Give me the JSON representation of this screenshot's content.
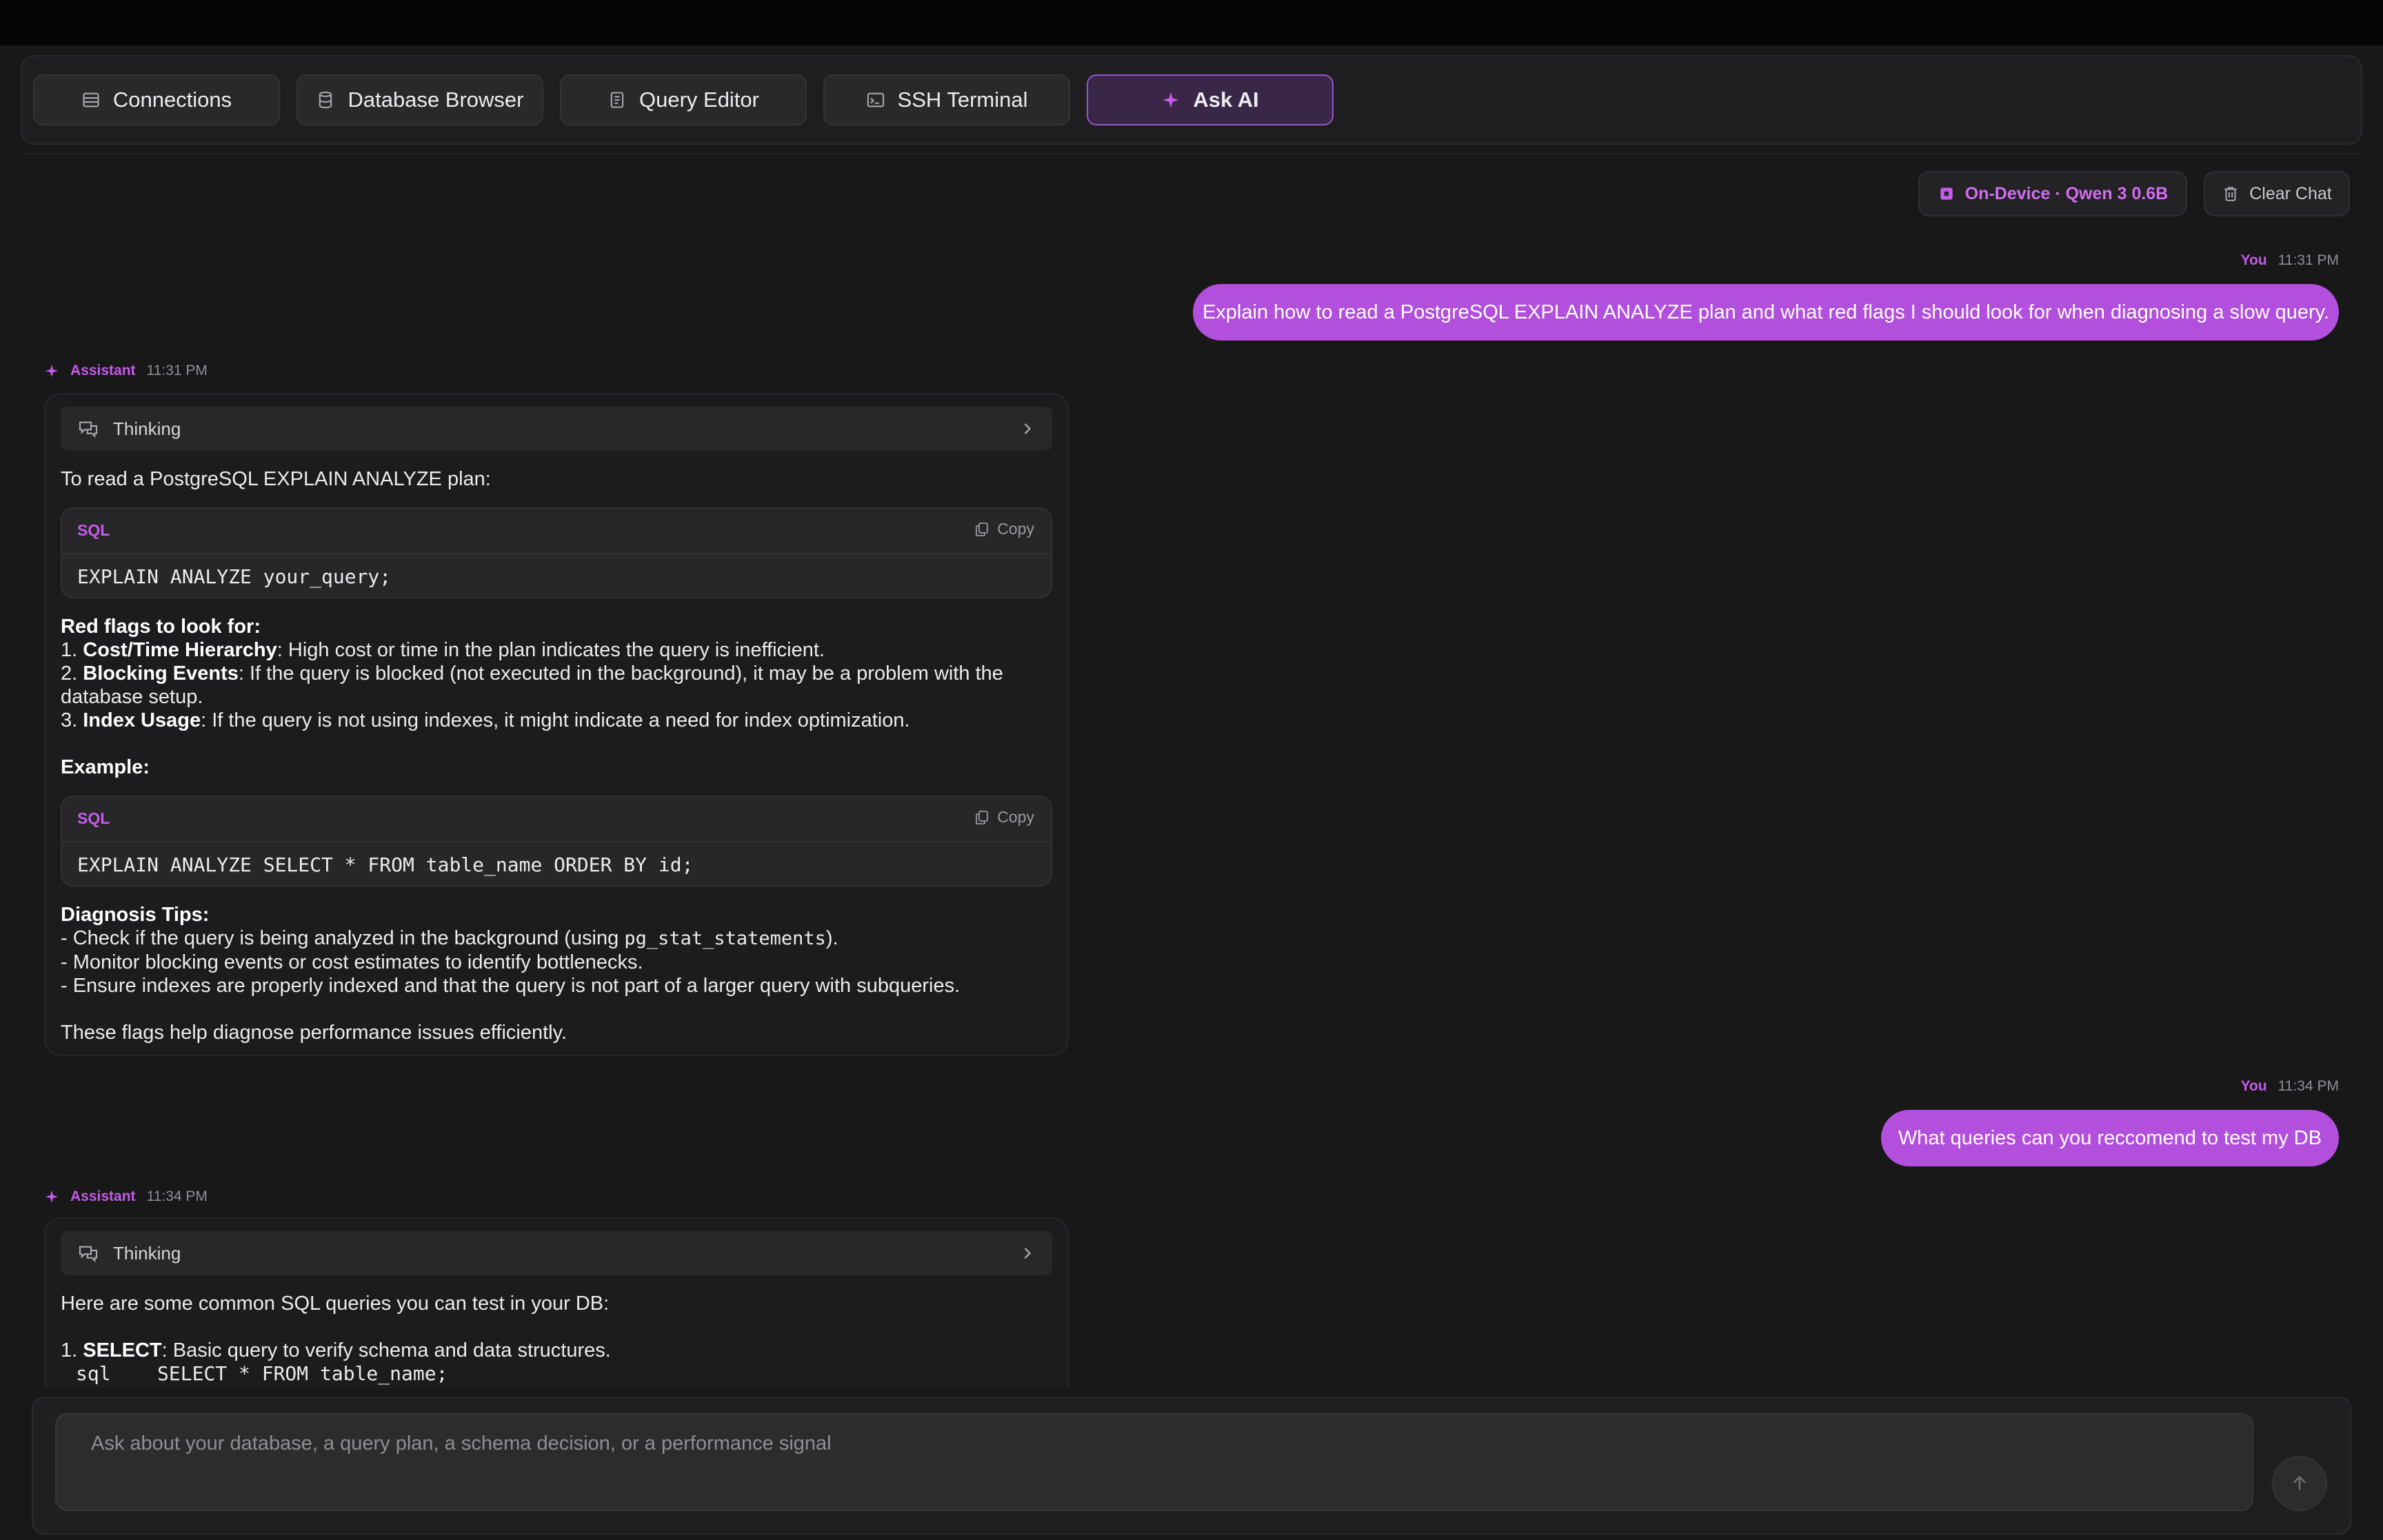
{
  "tabs": [
    {
      "label": "Connections",
      "icon": "server-icon"
    },
    {
      "label": "Database Browser",
      "icon": "database-icon"
    },
    {
      "label": "Query Editor",
      "icon": "file-icon"
    },
    {
      "label": "SSH Terminal",
      "icon": "terminal-icon"
    },
    {
      "label": "Ask AI",
      "icon": "sparkle-icon",
      "active": true
    }
  ],
  "header": {
    "model_label": "On-Device · Qwen 3 0.6B",
    "clear_label": "Clear Chat"
  },
  "messages": {
    "user1": {
      "who": "You",
      "time": "11:31 PM",
      "text": "Explain how to read a PostgreSQL EXPLAIN ANALYZE plan and what red flags I should look for when diagnosing a slow query."
    },
    "assistant1": {
      "who": "Assistant",
      "time": "11:31 PM",
      "thinking": "Thinking",
      "intro": "To read a PostgreSQL EXPLAIN ANALYZE plan:",
      "code1": {
        "lang": "SQL",
        "copy": "Copy",
        "code": "EXPLAIN ANALYZE your_query;"
      },
      "redflags_title": "Red flags to look for:",
      "flag1_num": "1. ",
      "flag1_bold": "Cost/Time Hierarchy",
      "flag1_rest": ": High cost or time in the plan indicates the query is inefficient.",
      "flag2_num": "2. ",
      "flag2_bold": "Blocking Events",
      "flag2_rest": ": If the query is blocked (not executed in the background), it may be a problem with the database setup.",
      "flag3_num": "3. ",
      "flag3_bold": "Index Usage",
      "flag3_rest": ": If the query is not using indexes, it might indicate a need for index optimization.",
      "example_title": "Example:",
      "code2": {
        "lang": "SQL",
        "copy": "Copy",
        "code": "EXPLAIN ANALYZE SELECT * FROM table_name ORDER BY id;"
      },
      "tips_title": "Diagnosis Tips:",
      "tip1_pre": "- Check if the query is being analyzed in the background (using ",
      "tip1_code": "pg_stat_statements",
      "tip1_post": ").",
      "tip2": "- Monitor blocking events or cost estimates to identify bottlenecks.",
      "tip3": "- Ensure indexes are properly indexed and that the query is not part of a larger query with subqueries.",
      "closing": "These flags help diagnose performance issues efficiently."
    },
    "user2": {
      "who": "You",
      "time": "11:34 PM",
      "text": "What queries can you reccomend to test my DB"
    },
    "assistant2": {
      "who": "Assistant",
      "time": "11:34 PM",
      "thinking": "Thinking",
      "intro": "Here are some common SQL queries you can test in your DB:",
      "item1_num": "1. ",
      "item1_bold": "SELECT",
      "item1_rest": ": Basic query to verify schema and data structures.",
      "item1_code": "sql    SELECT * FROM table_name;"
    }
  },
  "composer": {
    "placeholder": "Ask about your database, a query plan, a schema decision, or a performance signal"
  },
  "colors": {
    "accent": "#b24fdc",
    "accent_text": "#c65be9",
    "background": "#181819"
  }
}
